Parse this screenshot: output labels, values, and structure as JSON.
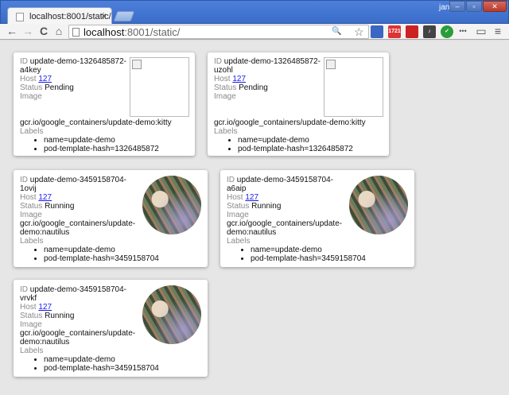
{
  "browser": {
    "tab_title": "localhost:8001/static/",
    "tab_close": "×",
    "user": "janet",
    "win_minimize": "–",
    "win_maximize": "▫",
    "win_close": "✕",
    "url_host": "localhost",
    "url_rest": ":8001/static/",
    "back_icon": "←",
    "forward_icon": "→",
    "reload_icon": "C",
    "home_icon": "⌂",
    "zoom_icon": "🔍",
    "star_icon": "☆",
    "extensions": [
      {
        "name": "extension-1",
        "text": "",
        "color": "#3b66c4"
      },
      {
        "name": "extension-gmail",
        "text": "1721",
        "color": "#d33"
      },
      {
        "name": "extension-red",
        "text": "",
        "color": "#c22"
      },
      {
        "name": "extension-music",
        "text": "♪",
        "color": "#444"
      },
      {
        "name": "extension-check",
        "text": "✓",
        "color": "#2a9d3a"
      }
    ],
    "more_icon": "•••",
    "cast_icon": "▭",
    "menu_icon": "≡"
  },
  "labels": {
    "id": "ID",
    "host": "Host",
    "status": "Status",
    "image": "Image",
    "labels": "Labels"
  },
  "pods": [
    {
      "id_line1": "update-demo-1326485872-",
      "id_line2": "a4key",
      "host": "127",
      "status": "Pending",
      "image_line1": "gcr.io/google_containers/update-demo:kitty",
      "image_line2": "",
      "labels": [
        "name=update-demo",
        "pod-template-hash=1326485872"
      ]
    },
    {
      "id_line1": "update-demo-1326485872-",
      "id_line2": "uzohl",
      "host": "127",
      "status": "Pending",
      "image_line1": "gcr.io/google_containers/update-demo:kitty",
      "image_line2": "",
      "labels": [
        "name=update-demo",
        "pod-template-hash=1326485872"
      ]
    },
    {
      "id_line1": "update-demo-3459158704-",
      "id_line2": "1ovij",
      "host": "127",
      "status": "Running",
      "image_line1": "gcr.io/google_containers/update-",
      "image_line2": "demo:nautilus",
      "labels": [
        "name=update-demo",
        "pod-template-hash=3459158704"
      ]
    },
    {
      "id_line1": "update-demo-3459158704-",
      "id_line2": "a6aip",
      "host": "127",
      "status": "Running",
      "image_line1": "gcr.io/google_containers/update-",
      "image_line2": "demo:nautilus",
      "labels": [
        "name=update-demo",
        "pod-template-hash=3459158704"
      ]
    },
    {
      "id_line1": "update-demo-3459158704-",
      "id_line2": "vrvkf",
      "host": "127",
      "status": "Running",
      "image_line1": "gcr.io/google_containers/update-",
      "image_line2": "demo:nautilus",
      "labels": [
        "name=update-demo",
        "pod-template-hash=3459158704"
      ]
    }
  ]
}
